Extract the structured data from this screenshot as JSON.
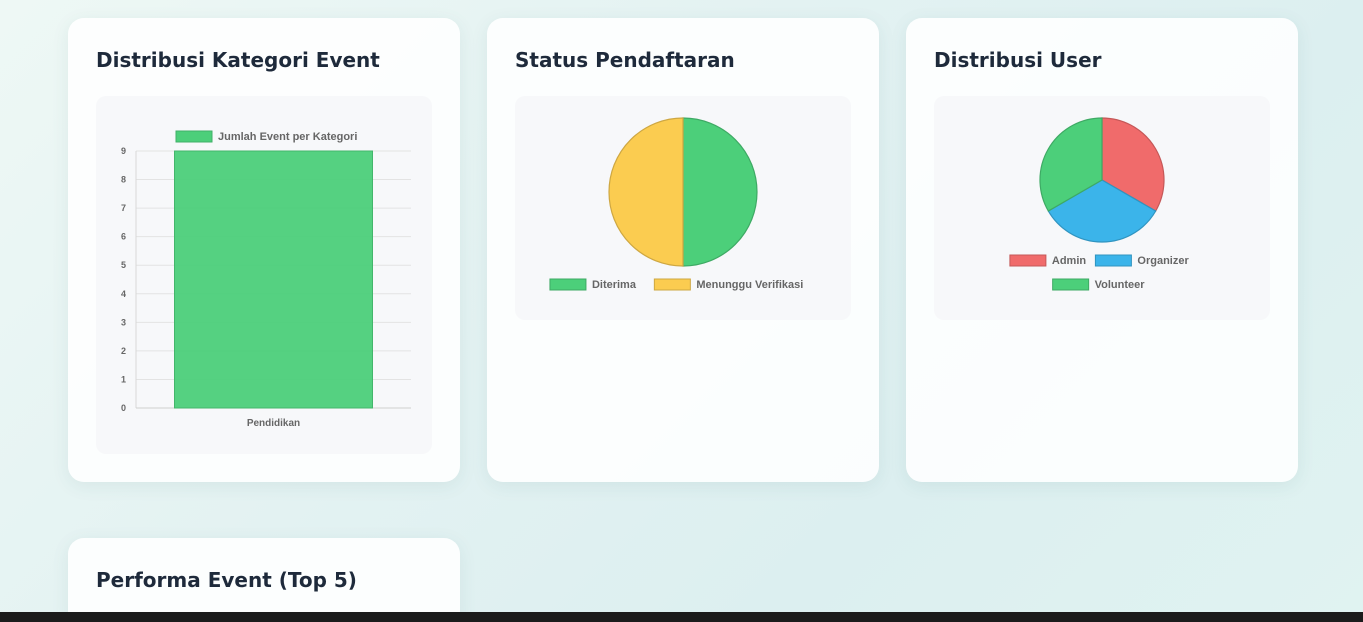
{
  "cards": {
    "kategori": {
      "title": "Distribusi Kategori Event"
    },
    "pendaftaran": {
      "title": "Status Pendaftaran"
    },
    "user": {
      "title": "Distribusi User"
    },
    "performa": {
      "title": "Performa Event (Top 5)"
    }
  },
  "chart_data": [
    {
      "type": "bar",
      "categories": [
        "Pendidikan"
      ],
      "series": [
        {
          "name": "Jumlah Event per Kategori",
          "values": [
            9
          ],
          "color": "#4ccf7a"
        }
      ],
      "yticks": [
        "0",
        "1",
        "2",
        "3",
        "4",
        "5",
        "6",
        "7",
        "8",
        "9"
      ],
      "ylim": [
        0,
        9
      ],
      "grid": true,
      "legend": "top"
    },
    {
      "type": "pie",
      "labels": [
        "Diterima",
        "Menunggu Verifikasi"
      ],
      "values": [
        1,
        1
      ],
      "colors": [
        "#4ccf7a",
        "#fbcc50"
      ],
      "legend": "bottom"
    },
    {
      "type": "pie",
      "labels": [
        "Admin",
        "Organizer",
        "Volunteer"
      ],
      "values": [
        1,
        1,
        1
      ],
      "colors": [
        "#f06b6b",
        "#3bb4ea",
        "#4ccf7a"
      ],
      "legend": "bottom"
    }
  ]
}
